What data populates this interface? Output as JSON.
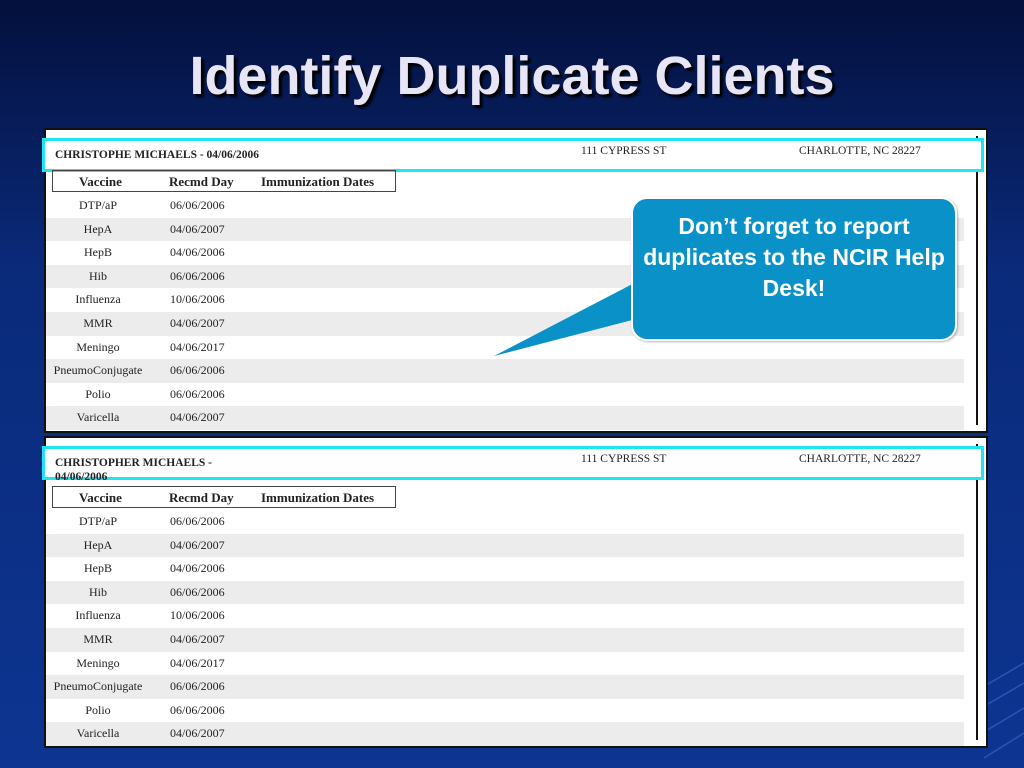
{
  "slide": {
    "title": "Identify Duplicate Clients"
  },
  "table_headers": {
    "vaccine": "Vaccine",
    "recmd_day": "Recmd Day",
    "immunization_dates": "Immunization Dates"
  },
  "clients": [
    {
      "name": "CHRISTOPHE MICHAELS - 04/06/2006",
      "address": "111 CYPRESS ST",
      "city": "CHARLOTTE, NC  28227",
      "rows": [
        {
          "vaccine": "DTP/aP",
          "day": "06/06/2006"
        },
        {
          "vaccine": "HepA",
          "day": "04/06/2007"
        },
        {
          "vaccine": "HepB",
          "day": "04/06/2006"
        },
        {
          "vaccine": "Hib",
          "day": "06/06/2006"
        },
        {
          "vaccine": "Influenza",
          "day": "10/06/2006"
        },
        {
          "vaccine": "MMR",
          "day": "04/06/2007"
        },
        {
          "vaccine": "Meningo",
          "day": "04/06/2017"
        },
        {
          "vaccine": "PneumoConjugate",
          "day": "06/06/2006"
        },
        {
          "vaccine": "Polio",
          "day": "06/06/2006"
        },
        {
          "vaccine": "Varicella",
          "day": "04/06/2007"
        }
      ]
    },
    {
      "name": "CHRISTOPHER MICHAELS - 04/06/2006",
      "address": "111 CYPRESS ST",
      "city": "CHARLOTTE, NC  28227",
      "rows": [
        {
          "vaccine": "DTP/aP",
          "day": "06/06/2006"
        },
        {
          "vaccine": "HepA",
          "day": "04/06/2007"
        },
        {
          "vaccine": "HepB",
          "day": "04/06/2006"
        },
        {
          "vaccine": "Hib",
          "day": "06/06/2006"
        },
        {
          "vaccine": "Influenza",
          "day": "10/06/2006"
        },
        {
          "vaccine": "MMR",
          "day": "04/06/2007"
        },
        {
          "vaccine": "Meningo",
          "day": "04/06/2017"
        },
        {
          "vaccine": "PneumoConjugate",
          "day": "06/06/2006"
        },
        {
          "vaccine": "Polio",
          "day": "06/06/2006"
        },
        {
          "vaccine": "Varicella",
          "day": "04/06/2007"
        }
      ]
    }
  ],
  "callout": {
    "text": "Don’t forget to report duplicates to the NCIR Help Desk!"
  },
  "colors": {
    "highlight": "#1ee6f0",
    "callout_bg": "#0a91c8",
    "background": "#0a2a7a"
  }
}
